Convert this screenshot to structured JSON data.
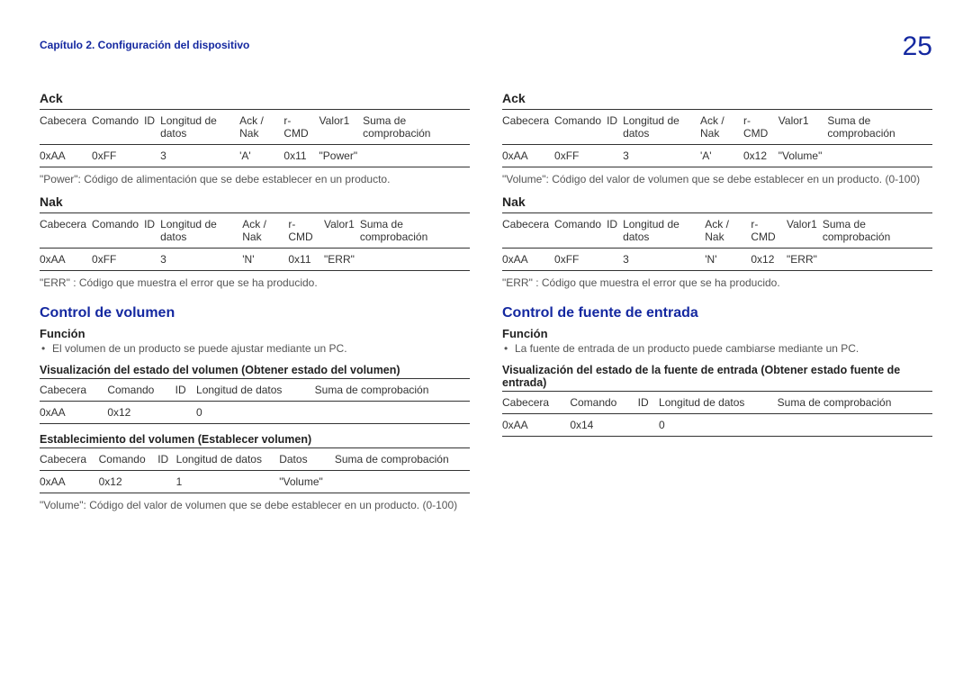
{
  "header": {
    "chapter": "Capítulo 2. Configuración del dispositivo",
    "page_number": "25"
  },
  "left": {
    "ack": {
      "title": "Ack",
      "headers": [
        "Cabecera",
        "Comando",
        "ID",
        "Longitud de datos",
        "Ack / Nak",
        "r-CMD",
        "Valor1",
        "Suma de comprobación"
      ],
      "row": [
        "0xAA",
        "0xFF",
        "",
        "3",
        "'A'",
        "0x11",
        "\"Power\"",
        ""
      ],
      "note": "\"Power\": Código de alimentación que se debe establecer en un producto."
    },
    "nak": {
      "title": "Nak",
      "headers": [
        "Cabecera",
        "Comando",
        "ID",
        "Longitud de datos",
        "Ack / Nak",
        "r-CMD",
        "Valor1",
        "Suma de comprobación"
      ],
      "row": [
        "0xAA",
        "0xFF",
        "",
        "3",
        "'N'",
        "0x11",
        "\"ERR\"",
        ""
      ],
      "note": "\"ERR\" : Código que muestra el error que se ha producido."
    },
    "section": {
      "title": "Control de volumen",
      "funcion_label": "Función",
      "bullet": "El volumen de un producto se puede ajustar mediante un PC.",
      "view_title": "Visualización del estado del volumen (Obtener estado del volumen)",
      "view_headers": [
        "Cabecera",
        "Comando",
        "ID",
        "Longitud de datos",
        "Suma de comprobación"
      ],
      "view_row": [
        "0xAA",
        "0x12",
        "",
        "0",
        ""
      ],
      "set_title": "Establecimiento del volumen (Establecer volumen)",
      "set_headers": [
        "Cabecera",
        "Comando",
        "ID",
        "Longitud de datos",
        "Datos",
        "Suma de comprobación"
      ],
      "set_row": [
        "0xAA",
        "0x12",
        "",
        "1",
        "\"Volume\"",
        ""
      ],
      "set_note": "\"Volume\": Código del valor de volumen que se debe establecer en un producto. (0-100)"
    }
  },
  "right": {
    "ack": {
      "title": "Ack",
      "headers": [
        "Cabecera",
        "Comando",
        "ID",
        "Longitud de datos",
        "Ack / Nak",
        "r-CMD",
        "Valor1",
        "Suma de comprobación"
      ],
      "row": [
        "0xAA",
        "0xFF",
        "",
        "3",
        "'A'",
        "0x12",
        "\"Volume\"",
        ""
      ],
      "note": "\"Volume\": Código del valor de volumen que se debe establecer en un producto. (0-100)"
    },
    "nak": {
      "title": "Nak",
      "headers": [
        "Cabecera",
        "Comando",
        "ID",
        "Longitud de datos",
        "Ack / Nak",
        "r-CMD",
        "Valor1",
        "Suma de comprobación"
      ],
      "row": [
        "0xAA",
        "0xFF",
        "",
        "3",
        "'N'",
        "0x12",
        "\"ERR\"",
        ""
      ],
      "note": "\"ERR\" : Código que muestra el error que se ha producido."
    },
    "section": {
      "title": "Control de fuente de entrada",
      "funcion_label": "Función",
      "bullet": "La fuente de entrada de un producto puede cambiarse mediante un PC.",
      "view_title": "Visualización del estado de la fuente de entrada (Obtener estado fuente de entrada)",
      "view_headers": [
        "Cabecera",
        "Comando",
        "ID",
        "Longitud de datos",
        "Suma de comprobación"
      ],
      "view_row": [
        "0xAA",
        "0x14",
        "",
        "0",
        ""
      ]
    }
  }
}
